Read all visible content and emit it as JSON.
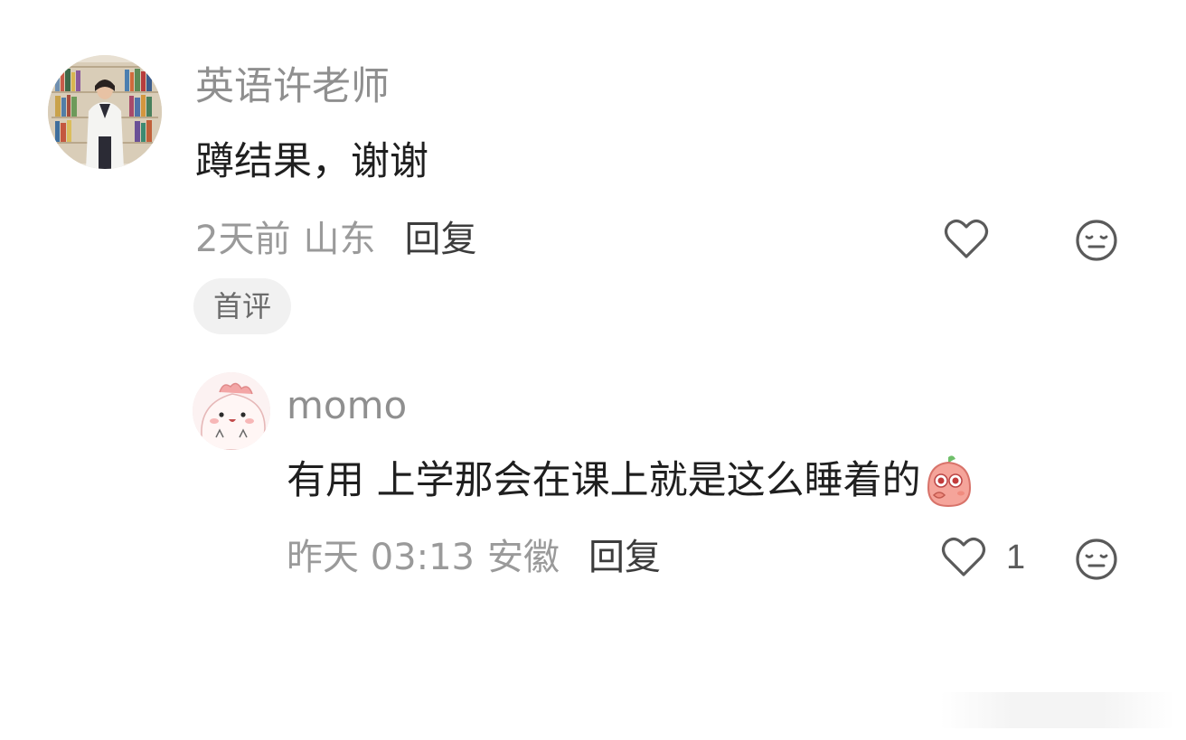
{
  "comment": {
    "username": "英语许老师",
    "text": "蹲结果，谢谢",
    "time": "2天前",
    "location": "山东",
    "reply_label": "回复",
    "badge": "首评",
    "avatar_icon": "person-photo-avatar",
    "like_icon": "heart-outline-icon",
    "reaction_icon": "neutral-face-icon"
  },
  "reply": {
    "username": "momo",
    "text": "有用 上学那会在课上就是这么睡着的",
    "sticker_icon": "peach-sticker-emoji",
    "time": "昨天 03:13",
    "location": "安徽",
    "reply_label": "回复",
    "like_count": "1",
    "avatar_icon": "pink-cartoon-avatar",
    "like_icon": "heart-outline-icon",
    "reaction_icon": "neutral-face-icon"
  },
  "colors": {
    "username": "#8f8f8f",
    "body_text": "#1f1f1f",
    "meta_text": "#9a9a9a",
    "badge_bg": "#f1f1f1",
    "icon": "#5a5a5a"
  }
}
